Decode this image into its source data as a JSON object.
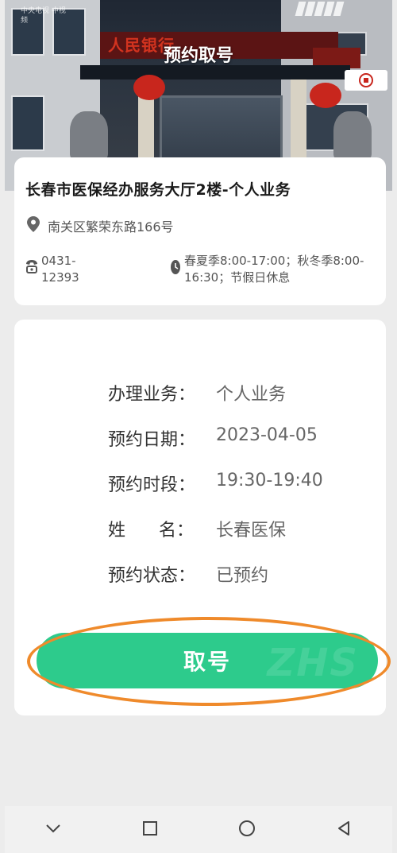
{
  "header": {
    "title": "预约取号",
    "building_sign": "人民银行",
    "watermark": "中央电视 中视频"
  },
  "location": {
    "name": "长春市医保经办服务大厅2楼-个人业务",
    "address": "南关区繁荣东路166号",
    "phone": "0431-12393",
    "hours": "春夏季8:00-17:00；秋冬季8:00-16:30；节假日休息"
  },
  "appointment": {
    "rows": [
      {
        "label": "办理业务：",
        "value": "个人业务"
      },
      {
        "label": "预约日期：",
        "value": "2023-04-05"
      },
      {
        "label": "预约时段：",
        "value": "19:30-19:40"
      },
      {
        "label": "姓      名：",
        "value": "长春医保"
      },
      {
        "label": "预约状态：",
        "value": "已预约"
      }
    ],
    "take_number_label": "取号"
  },
  "colors": {
    "primary_button": "#2dcb8c",
    "highlight_ring": "#ef8a2b"
  },
  "icons": {
    "address": "location-pin-icon",
    "phone": "phone-icon",
    "hours": "clock-icon",
    "nav": [
      "chevron-down-icon",
      "square-icon",
      "circle-icon",
      "triangle-back-icon"
    ]
  }
}
